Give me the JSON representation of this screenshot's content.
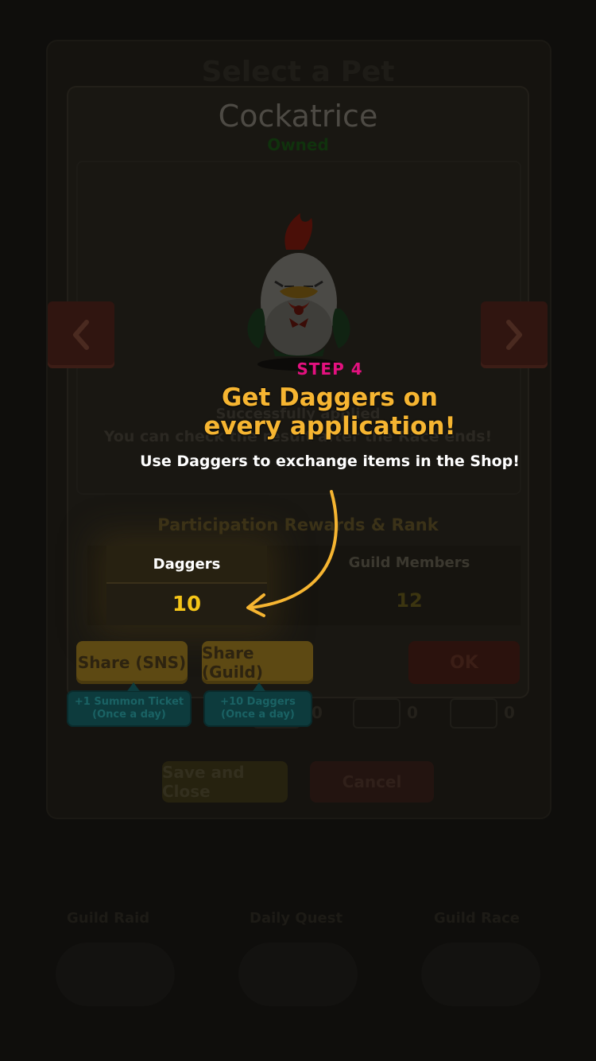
{
  "background": {
    "title": "Select a Pet",
    "save_button": "Save and Close",
    "cancel_button": "Cancel",
    "slot_values": [
      "0",
      "0",
      "0"
    ],
    "bottom_tabs": [
      "Guild Raid",
      "Daily Quest",
      "Guild Race"
    ]
  },
  "dialog": {
    "pet_name": "Cockatrice",
    "pet_status": "Owned",
    "applied_title": "Successfully applied",
    "applied_subtitle": "You can check the result after the Race ends!",
    "rewards_heading": "Participation Rewards & Rank",
    "daggers_label": "Daggers",
    "daggers_value": "10",
    "guild_members_label": "Guild Members",
    "guild_members_value": "12",
    "share_sns_label": "Share (SNS)",
    "share_sns_tip_line1": "+1 Summon Ticket",
    "share_sns_tip_line2": "(Once a day)",
    "share_guild_label": "Share (Guild)",
    "share_guild_tip_line1": "+10 Daggers",
    "share_guild_tip_line2": "(Once a day)",
    "ok_label": "OK"
  },
  "tutorial": {
    "step": "STEP 4",
    "title_line1": "Get Daggers on",
    "title_line2": "every application!",
    "description": "Use Daggers to exchange items in the Shop!"
  },
  "colors": {
    "step_pink": "#e3117f",
    "title_gold": "#f6b531",
    "daggers_value_yellow": "#f5c518",
    "arrow_gold": "#f6b531"
  }
}
